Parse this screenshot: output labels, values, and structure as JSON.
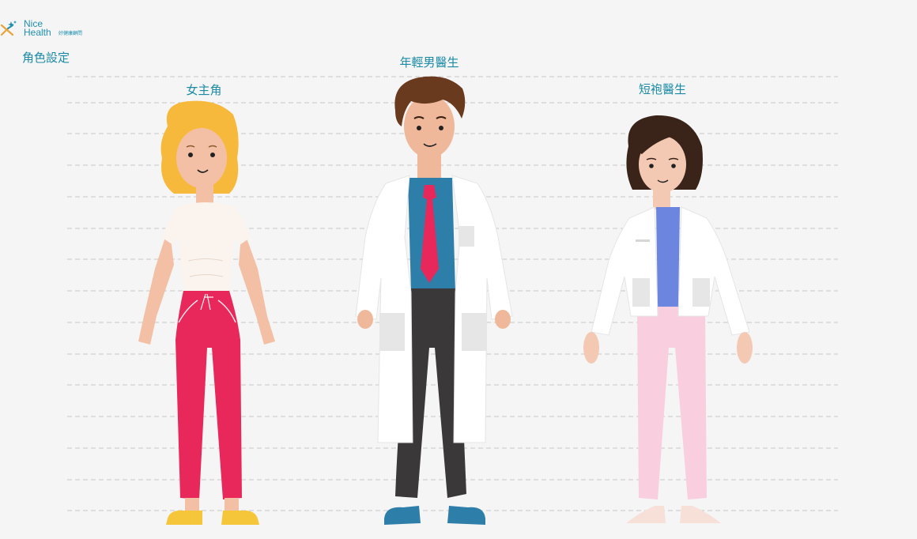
{
  "brand": {
    "line1": "Nice",
    "line2": "Health",
    "line3": "好健康顧問"
  },
  "page_title": "角色設定",
  "characters": [
    {
      "label": "女主角"
    },
    {
      "label": "年輕男醫生"
    },
    {
      "label": "短袍醫生"
    }
  ],
  "colors": {
    "accent": "#1a8aa6",
    "background": "#f5f5f5",
    "guide_line": "#c8c8c8"
  }
}
